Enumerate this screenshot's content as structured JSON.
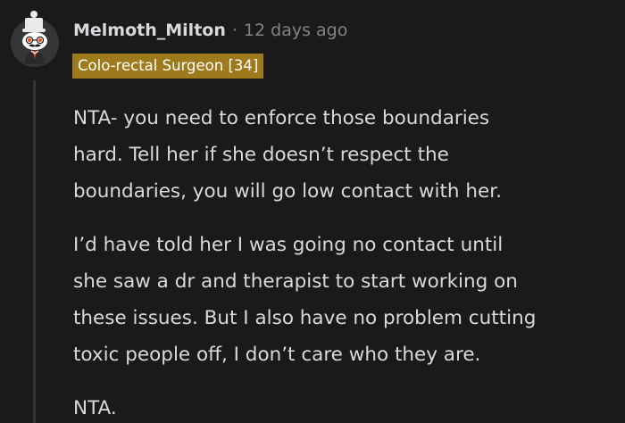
{
  "comment": {
    "username": "Melmoth_Milton",
    "separator": "·",
    "timestamp": "12 days ago",
    "flair": "Colo-rectal Surgeon [34]",
    "paragraphs": [
      "NTA- you need to enforce those boundaries\nhard. Tell her if she doesn’t respect the\nboundaries, you will go low contact with her.",
      "I’d have told her I was going no contact until\nshe saw a dr and therapist to start working on\nthese issues. But I also have no problem cutting\ntoxic people off, I don’t care who they are.",
      "NTA."
    ]
  },
  "colors": {
    "background": "#1a1a1b",
    "text": "#d7dadc",
    "meta": "#818384",
    "flair_bg": "#9e7a1d",
    "thread_line": "#343536"
  },
  "icons": {
    "avatar": "snoo-avatar-with-top-hat-monocle-mustache"
  }
}
